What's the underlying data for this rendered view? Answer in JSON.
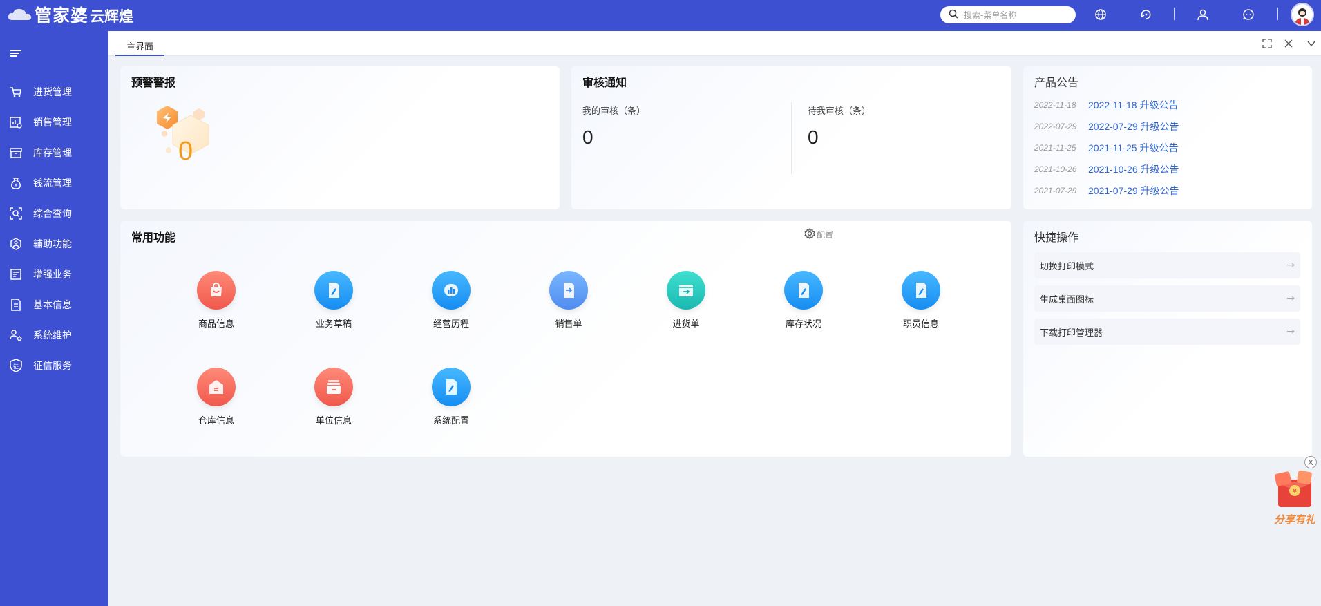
{
  "header": {
    "logo_main": "管家婆",
    "logo_sub": "云辉煌",
    "search_placeholder": "搜索-菜单名称"
  },
  "sidebar": {
    "items": [
      {
        "label": "进货管理",
        "icon": "cart-icon"
      },
      {
        "label": "销售管理",
        "icon": "sales-chart-icon"
      },
      {
        "label": "库存管理",
        "icon": "inventory-box-icon"
      },
      {
        "label": "钱流管理",
        "icon": "money-bag-icon"
      },
      {
        "label": "综合查询",
        "icon": "scan-search-icon"
      },
      {
        "label": "辅助功能",
        "icon": "assist-icon"
      },
      {
        "label": "增强业务",
        "icon": "business-doc-icon"
      },
      {
        "label": "基本信息",
        "icon": "info-doc-icon"
      },
      {
        "label": "系统维护",
        "icon": "maintenance-icon"
      },
      {
        "label": "征信服务",
        "icon": "credit-shield-icon"
      }
    ]
  },
  "tabs": {
    "main_label": "主界面"
  },
  "warning": {
    "title": "预警警报",
    "count": "0"
  },
  "audit": {
    "title": "审核通知",
    "mine_label": "我的审核（条）",
    "mine_value": "0",
    "pending_label": "待我审核（条）",
    "pending_value": "0"
  },
  "announcements": {
    "title": "产品公告",
    "items": [
      {
        "date": "2022-11-18",
        "title": "2022-11-18 升级公告"
      },
      {
        "date": "2022-07-29",
        "title": "2022-07-29 升级公告"
      },
      {
        "date": "2021-11-25",
        "title": "2021-11-25 升级公告"
      },
      {
        "date": "2021-10-26",
        "title": "2021-10-26 升级公告"
      },
      {
        "date": "2021-07-29",
        "title": "2021-07-29 升级公告"
      }
    ]
  },
  "functions": {
    "title": "常用功能",
    "config_label": "配置",
    "items": [
      {
        "label": "商品信息",
        "color": "#f0584c",
        "icon": "shopping-bag-icon"
      },
      {
        "label": "业务草稿",
        "color": "#168df2",
        "icon": "draft-edit-icon"
      },
      {
        "label": "经营历程",
        "color": "#168df2",
        "icon": "bar-chart-icon"
      },
      {
        "label": "销售单",
        "color": "#4f8cf0",
        "icon": "sales-order-icon"
      },
      {
        "label": "进货单",
        "color": "#1ab8b0",
        "icon": "purchase-order-icon"
      },
      {
        "label": "库存状况",
        "color": "#168df2",
        "icon": "stock-edit-icon"
      },
      {
        "label": "职员信息",
        "color": "#168df2",
        "icon": "staff-edit-icon"
      },
      {
        "label": "仓库信息",
        "color": "#f0584c",
        "icon": "warehouse-icon"
      },
      {
        "label": "单位信息",
        "color": "#f0584c",
        "icon": "unit-archive-icon"
      },
      {
        "label": "系统配置",
        "color": "#168df2",
        "icon": "config-edit-icon"
      }
    ]
  },
  "quick_ops": {
    "title": "快捷操作",
    "items": [
      {
        "label": "切换打印模式"
      },
      {
        "label": "生成桌面图标"
      },
      {
        "label": "下载打印管理器"
      }
    ]
  },
  "gift": {
    "label": "分享有礼",
    "close": "X"
  }
}
